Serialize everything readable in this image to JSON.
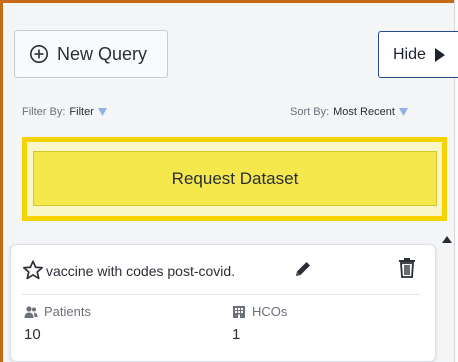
{
  "toolbar": {
    "new_query_label": "New Query",
    "hide_label": "Hide"
  },
  "filters": {
    "filter_by_label": "Filter By:",
    "filter_by_value": "Filter",
    "sort_by_label": "Sort By:",
    "sort_by_value": "Most Recent"
  },
  "request": {
    "label": "Request Dataset"
  },
  "queries": [
    {
      "title": "vaccine with codes post-covid.",
      "stats": [
        {
          "label": "Patients",
          "value": "10",
          "icon": "people-icon"
        },
        {
          "label": "HCOs",
          "value": "1",
          "icon": "building-icon"
        }
      ]
    }
  ],
  "colors": {
    "highlight_border": "#f5d200",
    "request_button": "#f4e84d",
    "hide_border": "#244c8a",
    "frame_border": "#c56a17",
    "caret": "#8fb3e8"
  }
}
